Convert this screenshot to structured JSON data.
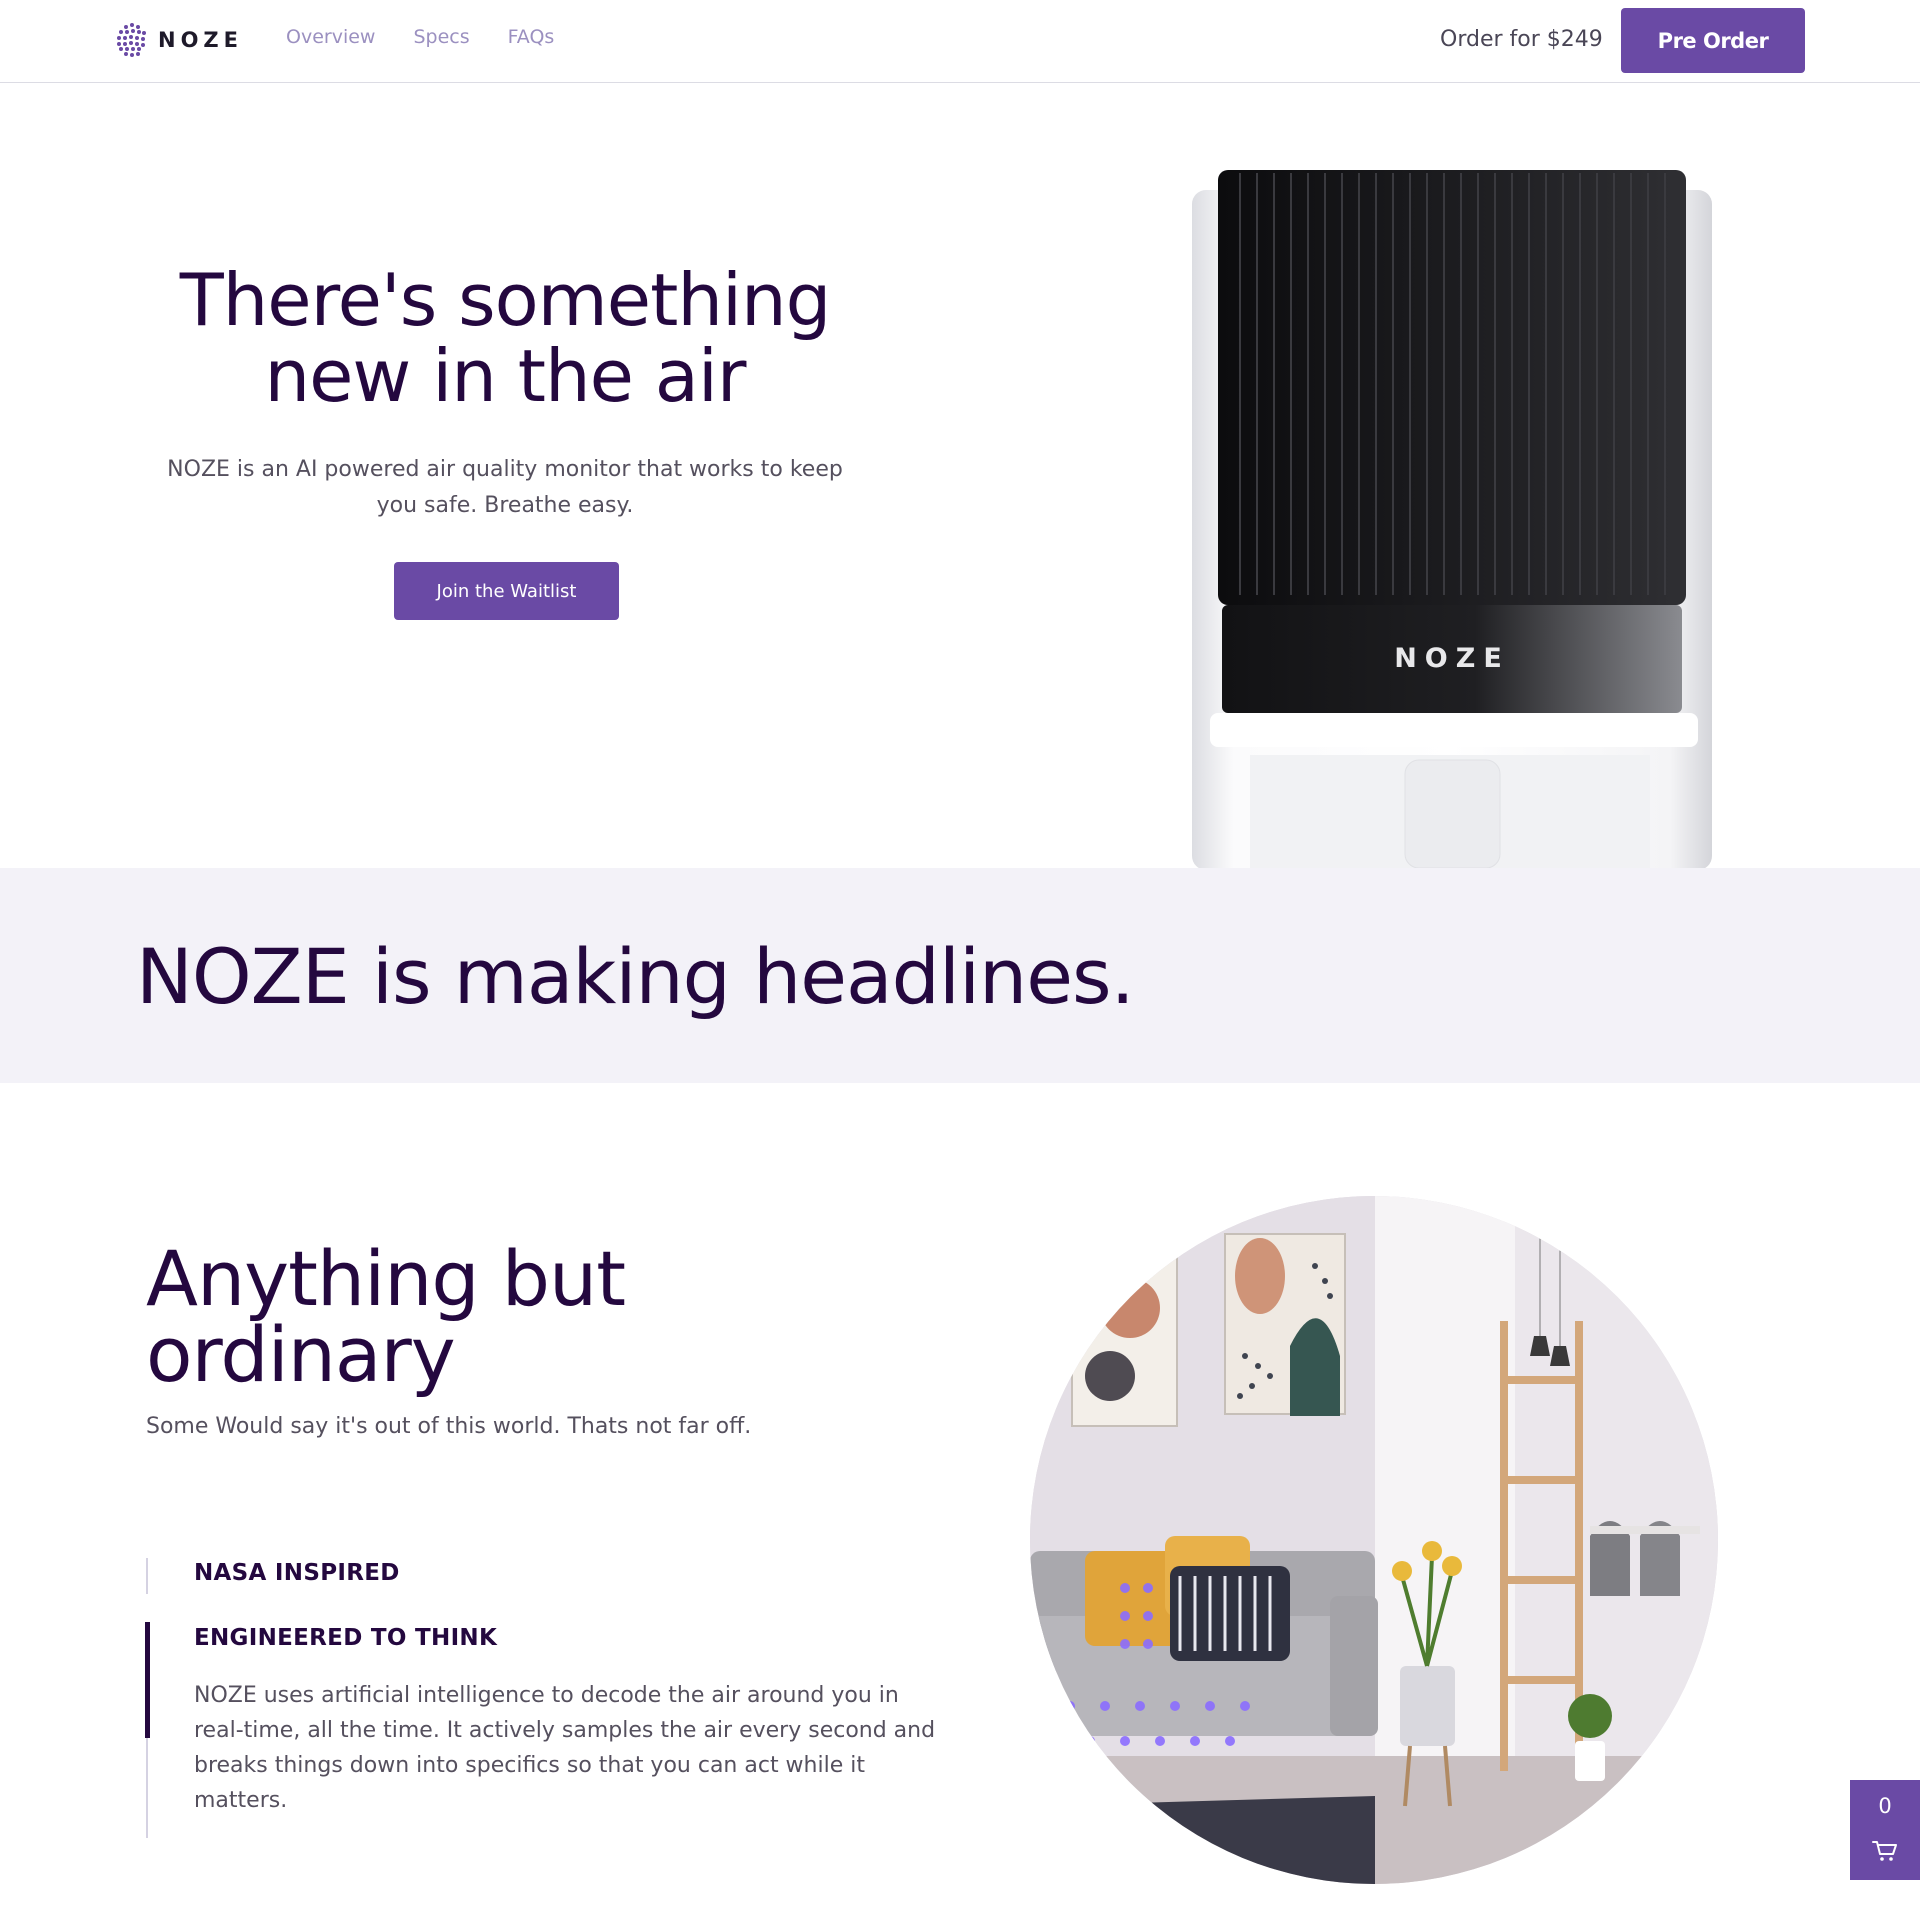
{
  "nav": {
    "brand": "NOZE",
    "links": [
      "Overview",
      "Specs",
      "FAQs"
    ],
    "order_text": "Order for $249",
    "preorder_label": "Pre Order"
  },
  "hero": {
    "title": "There's something new in the air",
    "subtitle": "NOZE is an AI powered air quality monitor that works to keep you safe. Breathe easy.",
    "cta_label": "Join the Waitlist",
    "device_brand": "NOZE"
  },
  "headlines": {
    "title": "NOZE is making headlines."
  },
  "features": {
    "title": "Anything but ordinary",
    "subtitle": "Some Would say it's out of this world. Thats not far off.",
    "tabs": [
      {
        "label": "NASA INSPIRED"
      },
      {
        "label": "ENGINEERED TO THINK"
      }
    ],
    "active_description": "NOZE uses artificial intelligence to decode the air around you in real-time, all the time. It actively samples the air every second and breaks things down into specifics so that you can act while it matters."
  },
  "cart": {
    "count": "0"
  },
  "colors": {
    "brand_purple": "#6a4aa5",
    "heading": "#24083f",
    "band_bg": "#f3f2f8"
  },
  "icons": [
    "noze-logo-icon",
    "cart-icon"
  ]
}
